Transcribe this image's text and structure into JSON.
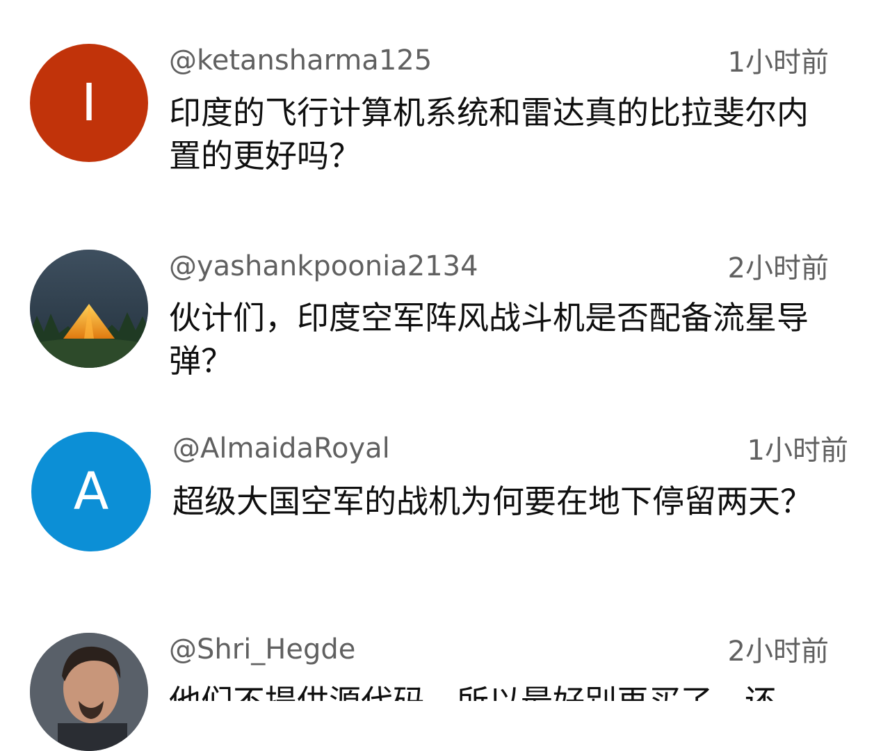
{
  "comments": [
    {
      "username": "@ketansharma125",
      "time": "1小时前",
      "text": "印度的飞行计算机系统和雷达真的比拉斐尔内置的更好吗？",
      "avatar": {
        "type": "letter",
        "letter": "I",
        "color": "#c1330a"
      }
    },
    {
      "username": "@yashankpoonia2134",
      "time": "2小时前",
      "text": "伙计们，印度空军阵风战斗机是否配备流星导弹？",
      "avatar": {
        "type": "image",
        "icon": "tent-at-night-icon"
      }
    },
    {
      "username": "@AlmaidaRoyal",
      "time": "1小时前",
      "text": "超级大国空军的战机为何要在地下停留两天？",
      "avatar": {
        "type": "letter",
        "letter": "A",
        "color": "#0c8fd6"
      }
    },
    {
      "username": "@Shri_Hegde",
      "time": "2小时前",
      "text": "他们不提供源代码，所以最好别再买了。还",
      "avatar": {
        "type": "image",
        "icon": "man-portrait-icon"
      }
    }
  ],
  "colors": {
    "secondary_text": "#606060",
    "primary_text": "#0f0f0f",
    "background": "#ffffff"
  }
}
